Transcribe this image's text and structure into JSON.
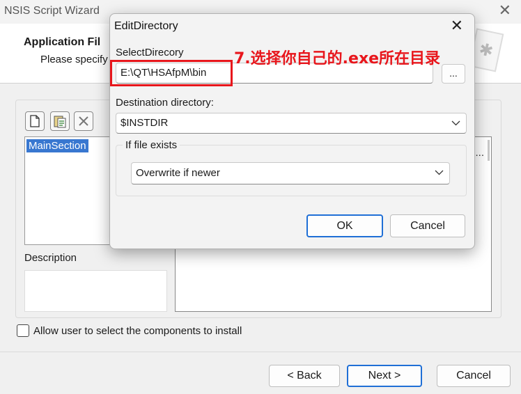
{
  "wizard": {
    "title": "NSIS Script Wizard",
    "heading": "Application Fil",
    "subheading": "Please specify",
    "sections": [
      "MainSection"
    ],
    "description_label": "Description",
    "allow_user_label": "Allow user to select the components to install",
    "allow_user_checked": false,
    "files_ellipsis": "...",
    "buttons": {
      "back": "< Back",
      "next": "Next >",
      "cancel": "Cancel"
    }
  },
  "dialog": {
    "title": "EditDirectory",
    "select_label": "SelectDirecory",
    "select_value": "E:\\QT\\HSAfpM\\bin",
    "browse_label": "...",
    "dest_label": "Destination directory:",
    "dest_value": "$INSTDIR",
    "if_exists_label": "If file exists",
    "if_exists_value": "Overwrite if newer",
    "ok_label": "OK",
    "cancel_label": "Cancel"
  },
  "annotation": {
    "text": "7.选择你自己的.exe所在目录",
    "color": "#e8161c"
  },
  "colors": {
    "accent": "#1f6fd6",
    "selection": "#3877d0"
  }
}
